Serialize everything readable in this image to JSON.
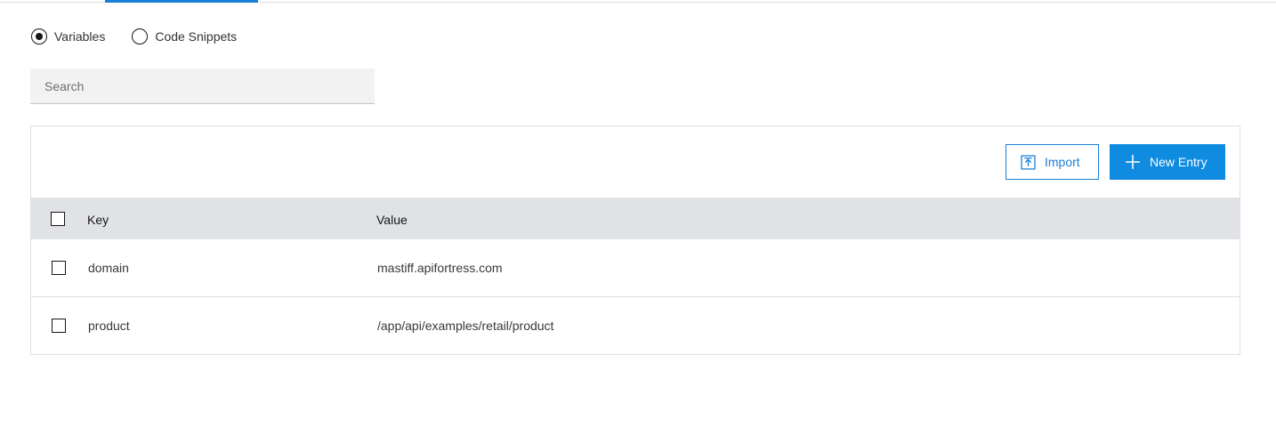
{
  "colors": {
    "accent": "#1a7fd6",
    "primary_button": "#0f8be0",
    "header_bg": "#e0e2e6",
    "search_bg": "#f2f2f2"
  },
  "view_toggle": {
    "options": [
      {
        "label": "Variables",
        "selected": true
      },
      {
        "label": "Code Snippets",
        "selected": false
      }
    ]
  },
  "search": {
    "placeholder": "Search",
    "value": ""
  },
  "toolbar": {
    "import_label": "Import",
    "import_icon": "import-icon",
    "new_entry_label": "New Entry",
    "new_entry_icon": "plus-icon"
  },
  "table": {
    "columns": [
      "Key",
      "Value"
    ],
    "rows": [
      {
        "key": "domain",
        "value": "mastiff.apifortress.com"
      },
      {
        "key": "product",
        "value": "/app/api/examples/retail/product"
      }
    ]
  }
}
